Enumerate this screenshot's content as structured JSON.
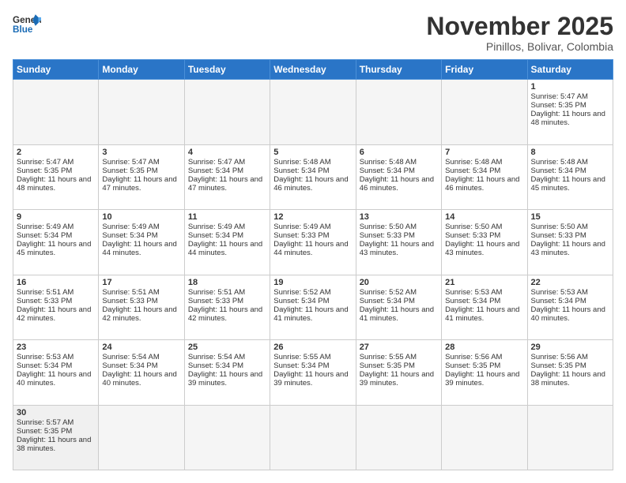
{
  "logo": {
    "general": "General",
    "blue": "Blue"
  },
  "header": {
    "title": "November 2025",
    "location": "Pinillos, Bolivar, Colombia"
  },
  "days": [
    "Sunday",
    "Monday",
    "Tuesday",
    "Wednesday",
    "Thursday",
    "Friday",
    "Saturday"
  ],
  "weeks": [
    [
      {
        "day": "",
        "sunrise": "",
        "sunset": "",
        "daylight": "",
        "empty": true
      },
      {
        "day": "",
        "sunrise": "",
        "sunset": "",
        "daylight": "",
        "empty": true
      },
      {
        "day": "",
        "sunrise": "",
        "sunset": "",
        "daylight": "",
        "empty": true
      },
      {
        "day": "",
        "sunrise": "",
        "sunset": "",
        "daylight": "",
        "empty": true
      },
      {
        "day": "",
        "sunrise": "",
        "sunset": "",
        "daylight": "",
        "empty": true
      },
      {
        "day": "",
        "sunrise": "",
        "sunset": "",
        "daylight": "",
        "empty": true
      },
      {
        "day": "1",
        "sunrise": "Sunrise: 5:47 AM",
        "sunset": "Sunset: 5:35 PM",
        "daylight": "Daylight: 11 hours and 48 minutes.",
        "empty": false
      }
    ],
    [
      {
        "day": "2",
        "sunrise": "Sunrise: 5:47 AM",
        "sunset": "Sunset: 5:35 PM",
        "daylight": "Daylight: 11 hours and 48 minutes.",
        "empty": false
      },
      {
        "day": "3",
        "sunrise": "Sunrise: 5:47 AM",
        "sunset": "Sunset: 5:35 PM",
        "daylight": "Daylight: 11 hours and 47 minutes.",
        "empty": false
      },
      {
        "day": "4",
        "sunrise": "Sunrise: 5:47 AM",
        "sunset": "Sunset: 5:34 PM",
        "daylight": "Daylight: 11 hours and 47 minutes.",
        "empty": false
      },
      {
        "day": "5",
        "sunrise": "Sunrise: 5:48 AM",
        "sunset": "Sunset: 5:34 PM",
        "daylight": "Daylight: 11 hours and 46 minutes.",
        "empty": false
      },
      {
        "day": "6",
        "sunrise": "Sunrise: 5:48 AM",
        "sunset": "Sunset: 5:34 PM",
        "daylight": "Daylight: 11 hours and 46 minutes.",
        "empty": false
      },
      {
        "day": "7",
        "sunrise": "Sunrise: 5:48 AM",
        "sunset": "Sunset: 5:34 PM",
        "daylight": "Daylight: 11 hours and 46 minutes.",
        "empty": false
      },
      {
        "day": "8",
        "sunrise": "Sunrise: 5:48 AM",
        "sunset": "Sunset: 5:34 PM",
        "daylight": "Daylight: 11 hours and 45 minutes.",
        "empty": false
      }
    ],
    [
      {
        "day": "9",
        "sunrise": "Sunrise: 5:49 AM",
        "sunset": "Sunset: 5:34 PM",
        "daylight": "Daylight: 11 hours and 45 minutes.",
        "empty": false
      },
      {
        "day": "10",
        "sunrise": "Sunrise: 5:49 AM",
        "sunset": "Sunset: 5:34 PM",
        "daylight": "Daylight: 11 hours and 44 minutes.",
        "empty": false
      },
      {
        "day": "11",
        "sunrise": "Sunrise: 5:49 AM",
        "sunset": "Sunset: 5:34 PM",
        "daylight": "Daylight: 11 hours and 44 minutes.",
        "empty": false
      },
      {
        "day": "12",
        "sunrise": "Sunrise: 5:49 AM",
        "sunset": "Sunset: 5:33 PM",
        "daylight": "Daylight: 11 hours and 44 minutes.",
        "empty": false
      },
      {
        "day": "13",
        "sunrise": "Sunrise: 5:50 AM",
        "sunset": "Sunset: 5:33 PM",
        "daylight": "Daylight: 11 hours and 43 minutes.",
        "empty": false
      },
      {
        "day": "14",
        "sunrise": "Sunrise: 5:50 AM",
        "sunset": "Sunset: 5:33 PM",
        "daylight": "Daylight: 11 hours and 43 minutes.",
        "empty": false
      },
      {
        "day": "15",
        "sunrise": "Sunrise: 5:50 AM",
        "sunset": "Sunset: 5:33 PM",
        "daylight": "Daylight: 11 hours and 43 minutes.",
        "empty": false
      }
    ],
    [
      {
        "day": "16",
        "sunrise": "Sunrise: 5:51 AM",
        "sunset": "Sunset: 5:33 PM",
        "daylight": "Daylight: 11 hours and 42 minutes.",
        "empty": false
      },
      {
        "day": "17",
        "sunrise": "Sunrise: 5:51 AM",
        "sunset": "Sunset: 5:33 PM",
        "daylight": "Daylight: 11 hours and 42 minutes.",
        "empty": false
      },
      {
        "day": "18",
        "sunrise": "Sunrise: 5:51 AM",
        "sunset": "Sunset: 5:33 PM",
        "daylight": "Daylight: 11 hours and 42 minutes.",
        "empty": false
      },
      {
        "day": "19",
        "sunrise": "Sunrise: 5:52 AM",
        "sunset": "Sunset: 5:34 PM",
        "daylight": "Daylight: 11 hours and 41 minutes.",
        "empty": false
      },
      {
        "day": "20",
        "sunrise": "Sunrise: 5:52 AM",
        "sunset": "Sunset: 5:34 PM",
        "daylight": "Daylight: 11 hours and 41 minutes.",
        "empty": false
      },
      {
        "day": "21",
        "sunrise": "Sunrise: 5:53 AM",
        "sunset": "Sunset: 5:34 PM",
        "daylight": "Daylight: 11 hours and 41 minutes.",
        "empty": false
      },
      {
        "day": "22",
        "sunrise": "Sunrise: 5:53 AM",
        "sunset": "Sunset: 5:34 PM",
        "daylight": "Daylight: 11 hours and 40 minutes.",
        "empty": false
      }
    ],
    [
      {
        "day": "23",
        "sunrise": "Sunrise: 5:53 AM",
        "sunset": "Sunset: 5:34 PM",
        "daylight": "Daylight: 11 hours and 40 minutes.",
        "empty": false
      },
      {
        "day": "24",
        "sunrise": "Sunrise: 5:54 AM",
        "sunset": "Sunset: 5:34 PM",
        "daylight": "Daylight: 11 hours and 40 minutes.",
        "empty": false
      },
      {
        "day": "25",
        "sunrise": "Sunrise: 5:54 AM",
        "sunset": "Sunset: 5:34 PM",
        "daylight": "Daylight: 11 hours and 39 minutes.",
        "empty": false
      },
      {
        "day": "26",
        "sunrise": "Sunrise: 5:55 AM",
        "sunset": "Sunset: 5:34 PM",
        "daylight": "Daylight: 11 hours and 39 minutes.",
        "empty": false
      },
      {
        "day": "27",
        "sunrise": "Sunrise: 5:55 AM",
        "sunset": "Sunset: 5:35 PM",
        "daylight": "Daylight: 11 hours and 39 minutes.",
        "empty": false
      },
      {
        "day": "28",
        "sunrise": "Sunrise: 5:56 AM",
        "sunset": "Sunset: 5:35 PM",
        "daylight": "Daylight: 11 hours and 39 minutes.",
        "empty": false
      },
      {
        "day": "29",
        "sunrise": "Sunrise: 5:56 AM",
        "sunset": "Sunset: 5:35 PM",
        "daylight": "Daylight: 11 hours and 38 minutes.",
        "empty": false
      }
    ],
    [
      {
        "day": "30",
        "sunrise": "Sunrise: 5:57 AM",
        "sunset": "Sunset: 5:35 PM",
        "daylight": "Daylight: 11 hours and 38 minutes.",
        "empty": false
      },
      {
        "day": "",
        "sunrise": "",
        "sunset": "",
        "daylight": "",
        "empty": true
      },
      {
        "day": "",
        "sunrise": "",
        "sunset": "",
        "daylight": "",
        "empty": true
      },
      {
        "day": "",
        "sunrise": "",
        "sunset": "",
        "daylight": "",
        "empty": true
      },
      {
        "day": "",
        "sunrise": "",
        "sunset": "",
        "daylight": "",
        "empty": true
      },
      {
        "day": "",
        "sunrise": "",
        "sunset": "",
        "daylight": "",
        "empty": true
      },
      {
        "day": "",
        "sunrise": "",
        "sunset": "",
        "daylight": "",
        "empty": true
      }
    ]
  ]
}
